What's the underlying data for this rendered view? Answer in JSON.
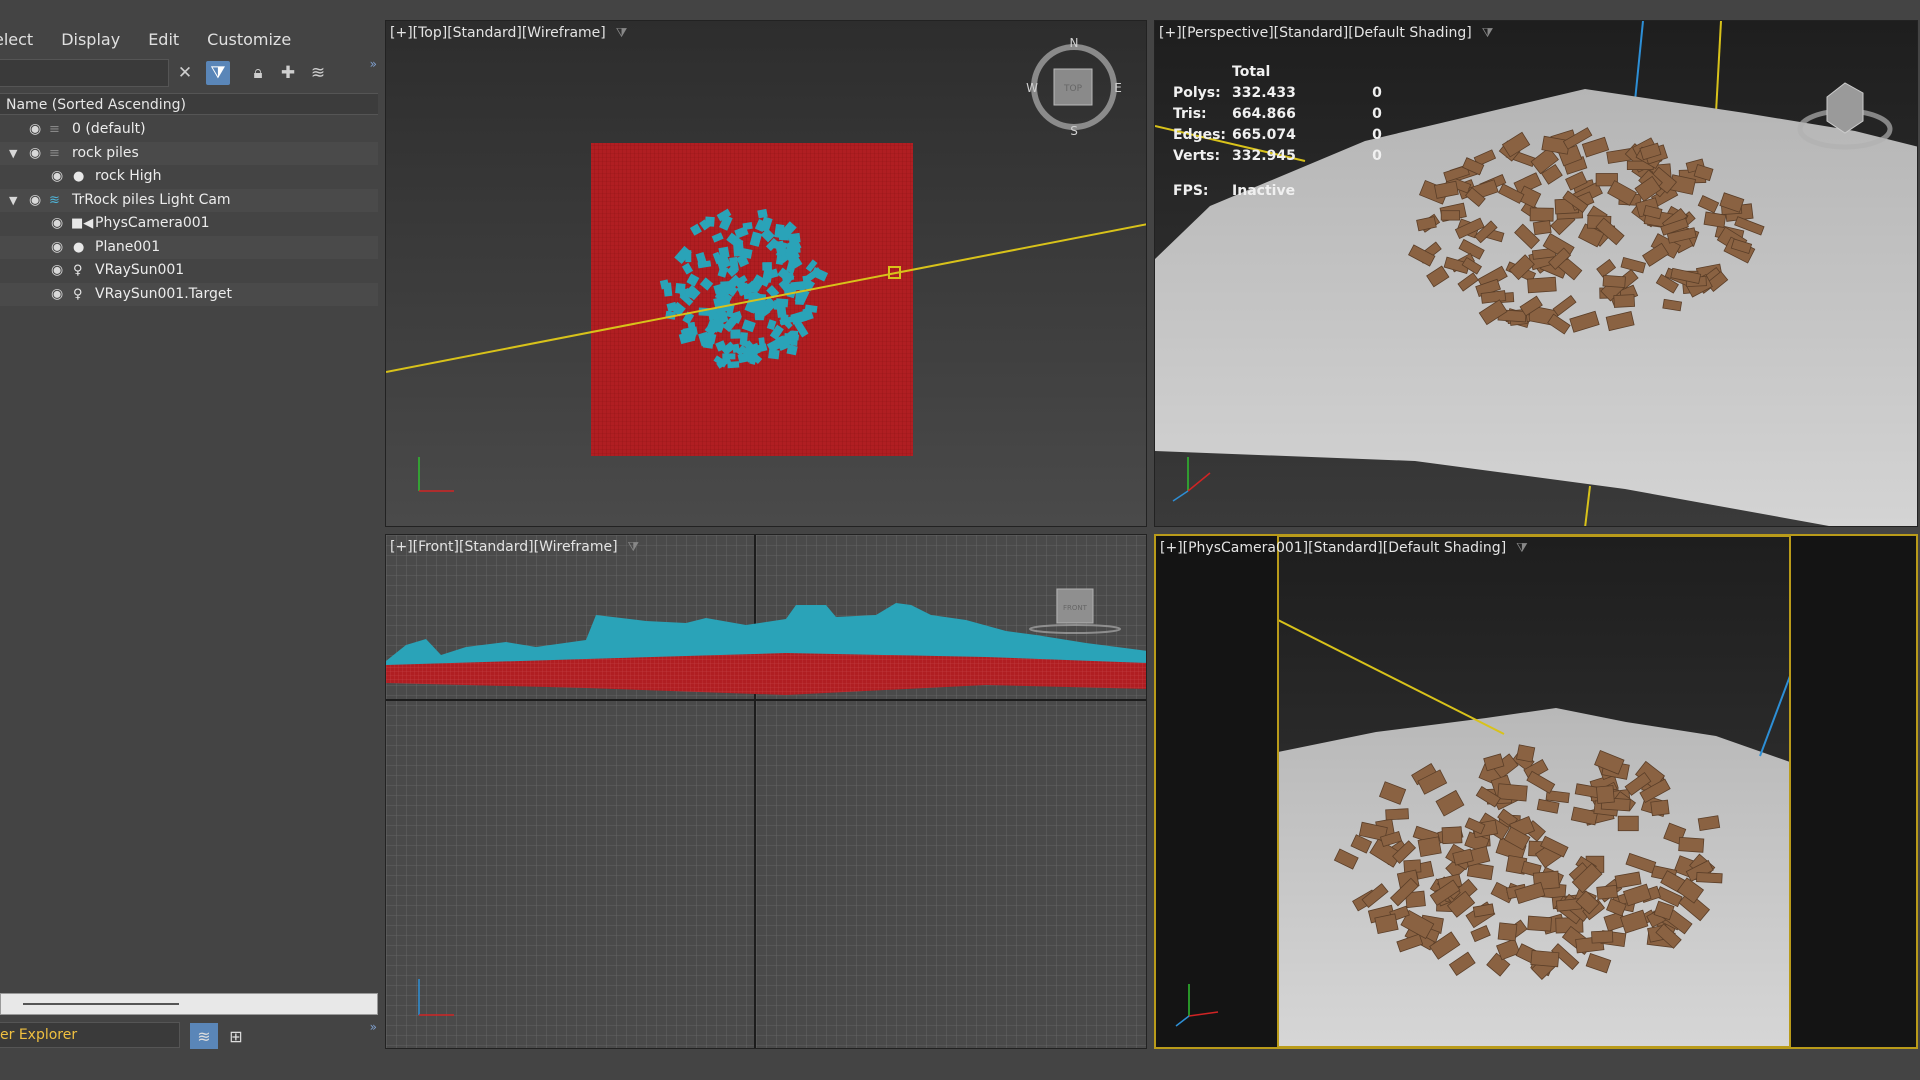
{
  "menu": {
    "select": "elect",
    "display": "Display",
    "edit": "Edit",
    "customize": "Customize"
  },
  "scene_explorer": {
    "column_header": "Name (Sorted Ascending)",
    "items": [
      {
        "label": "0 (default)",
        "icon": "layer-icon"
      },
      {
        "label": "rock piles",
        "icon": "layer-icon"
      },
      {
        "label": "rock High",
        "icon": "sphere-icon"
      },
      {
        "label": "TrRock piles Light Cam",
        "icon": "layer-stack-icon"
      },
      {
        "label": "PhysCamera001",
        "icon": "camera-icon"
      },
      {
        "label": "Plane001",
        "icon": "sphere-icon"
      },
      {
        "label": "VRaySun001",
        "icon": "light-icon"
      },
      {
        "label": "VRaySun001.Target",
        "icon": "light-icon"
      }
    ],
    "explorer_name": "er Explorer"
  },
  "viewports": {
    "top": {
      "label": "[+][Top][Standard][Wireframe]",
      "compass": {
        "n": "N",
        "s": "S",
        "e": "E",
        "w": "W",
        "cube": "TOP"
      }
    },
    "perspective": {
      "label": "[+][Perspective][Standard][Default Shading]",
      "stats": {
        "total": "Total",
        "polys_label": "Polys:",
        "polys": "332.433",
        "polys_sel": "0",
        "tris_label": "Tris:",
        "tris": "664.866",
        "tris_sel": "0",
        "edges_label": "Edges:",
        "edges": "665.074",
        "edges_sel": "0",
        "verts_label": "Verts:",
        "verts": "332.945",
        "verts_sel": "0",
        "fps_label": "FPS:",
        "fps": "Inactive"
      }
    },
    "front": {
      "label": "[+][Front][Standard][Wireframe]",
      "cube": "FRONT"
    },
    "camera": {
      "label": "[+][PhysCamera001][Standard][Default Shading]"
    }
  },
  "colors": {
    "wire_red": "#b01e22",
    "wire_cyan": "#2aa3b8",
    "sun_yellow": "#d8c21a",
    "selection_border": "#b99b1a",
    "brick": "#8a6242"
  }
}
